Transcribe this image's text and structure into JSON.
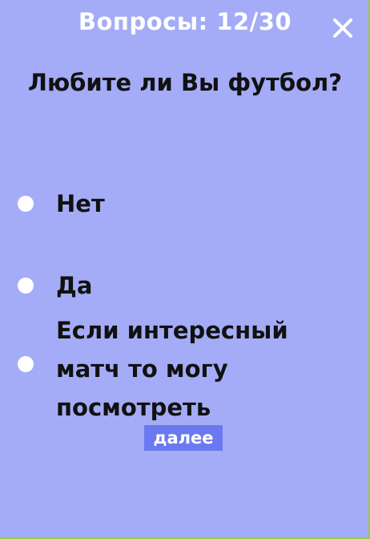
{
  "header": {
    "counter_text": "Вопросы: 12/30"
  },
  "question": {
    "text": "Любите ли Вы футбол?"
  },
  "options": [
    {
      "label": "Нет"
    },
    {
      "label": "Да"
    },
    {
      "label": "Если интересный\nматч то могу\nпосмотреть"
    }
  ],
  "actions": {
    "next_label": "далее"
  },
  "icons": {
    "close": "close-icon",
    "radio": "radio-circle"
  },
  "colors": {
    "background": "#a4acf7",
    "button": "#6b79f0",
    "text": "#111111",
    "header_text": "#ffffff"
  }
}
